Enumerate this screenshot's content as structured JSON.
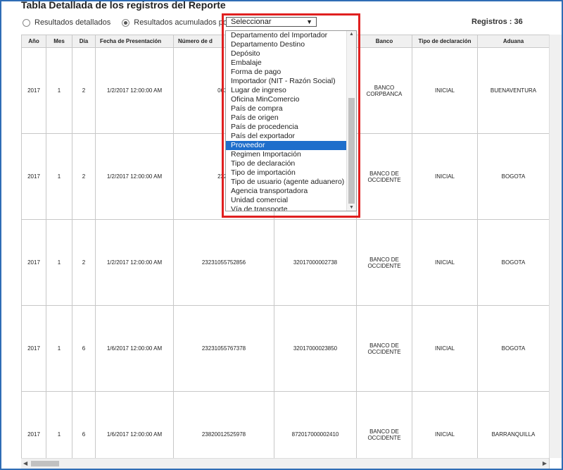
{
  "title": "Tabla Detallada de los registros del Reporte",
  "radios": [
    {
      "label": "Resultados detallados",
      "checked": false
    },
    {
      "label": "Resultados acumulados por",
      "checked": true
    }
  ],
  "select": {
    "value": "Seleccionar"
  },
  "records": "Registros : 36",
  "table": {
    "headers": [
      "Año",
      "Mes",
      "Día",
      "Fecha de Presentación",
      "Número de d",
      "",
      "Banco",
      "Tipo de declaración",
      "Aduana"
    ],
    "rows": [
      [
        "2017",
        "1",
        "2",
        "1/2/2017 12:00:00 AM",
        "0630",
        "",
        "BANCO CORPBANCA",
        "INICIAL",
        "BUENAVENTURA"
      ],
      [
        "2017",
        "1",
        "2",
        "1/2/2017 12:00:00 AM",
        "2323",
        "",
        "BANCO DE OCCIDENTE",
        "INICIAL",
        "BOGOTA"
      ],
      [
        "2017",
        "1",
        "2",
        "1/2/2017 12:00:00 AM",
        "23231055752856",
        "32017000002738",
        "BANCO DE OCCIDENTE",
        "INICIAL",
        "BOGOTA"
      ],
      [
        "2017",
        "1",
        "6",
        "1/6/2017 12:00:00 AM",
        "23231055767378",
        "32017000023850",
        "BANCO DE OCCIDENTE",
        "INICIAL",
        "BOGOTA"
      ],
      [
        "2017",
        "1",
        "6",
        "1/6/2017 12:00:00 AM",
        "23820012525978",
        "872017000002410",
        "BANCO DE OCCIDENTE",
        "INICIAL",
        "BARRANQUILLA"
      ]
    ]
  },
  "dropdown": {
    "items": [
      "Departamento del Importador",
      "Departamento Destino",
      "Depósito",
      "Embalaje",
      "Forma de pago",
      "Importador (NIT - Razón Social)",
      "Lugar de ingreso",
      "Oficina MinComercio",
      "País de compra",
      "País de origen",
      "País de procedencia",
      "País del exportador",
      "Proveedor",
      "Regimen Importación",
      "Tipo de declaración",
      "Tipo de importación",
      "Tipo de usuario (agente aduanero)",
      "Agencia transportadora",
      "Unidad comercial",
      "Vía de transporte"
    ],
    "selected_index": 12
  },
  "icons": {
    "select_arrow": "▼",
    "scroll_up": "▲",
    "scroll_down": "▼",
    "scroll_left": "◀",
    "scroll_right": "▶"
  },
  "colors": {
    "frame_border": "#2f6db5",
    "highlight_border": "#e02020",
    "selected_bg": "#1e6ecb"
  }
}
